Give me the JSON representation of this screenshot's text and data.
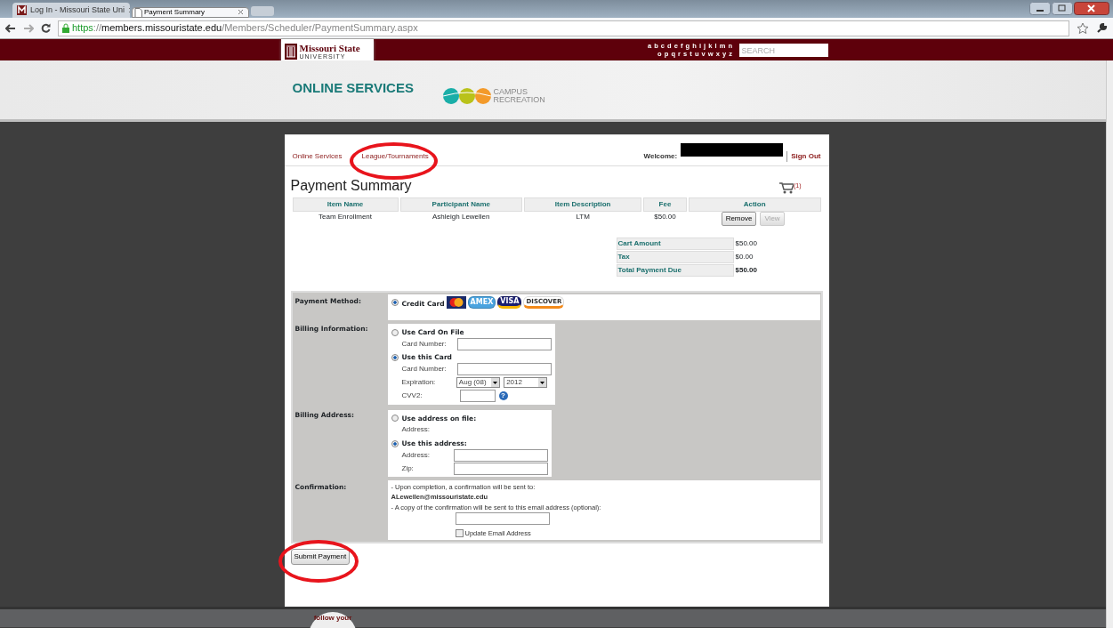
{
  "browser": {
    "tabs": [
      {
        "title": "Log In - Missouri State Uni",
        "selected": false
      },
      {
        "title": "Payment Summary",
        "selected": true
      }
    ],
    "url": {
      "scheme": "https",
      "separator": "://",
      "host": "members.missouristate.edu",
      "path": "/Members/Scheduler/PaymentSummary.aspx"
    }
  },
  "header": {
    "logo_text": "Missouri State",
    "logo_subtext": "UNIVERSITY",
    "az_rows": [
      "a b c d e f g h i j k l m n",
      "o p q r s t u v w x y z"
    ],
    "search": {
      "placeholder": "SEARCH"
    },
    "title": "ONLINE SERVICES",
    "partner": [
      "CAMPUS",
      "RECREATION"
    ]
  },
  "breadcrumb": [
    {
      "label": "Online Services"
    },
    {
      "label": "League/Tournaments"
    }
  ],
  "welcome": {
    "label": "Welcome:"
  },
  "sign_out": "Sign Out",
  "title": "Payment Summary",
  "cart_count": "(1)",
  "items_table": {
    "columns": [
      "Item Name",
      "Participant Name",
      "Item Description",
      "Fee",
      "Action"
    ],
    "rows": [
      {
        "cells": [
          "Team Enrollment",
          "Ashleigh Lewellen",
          "LTM",
          "$50.00"
        ],
        "actions": [
          {
            "label": "Remove",
            "disabled": false
          },
          {
            "label": "View",
            "disabled": true
          }
        ]
      }
    ]
  },
  "totals": [
    {
      "label": "Cart Amount",
      "value": "$50.00",
      "bold": false
    },
    {
      "label": "Tax",
      "value": "$0.00",
      "bold": false
    },
    {
      "label": "Total Payment Due",
      "value": "$50.00",
      "bold": true
    }
  ],
  "payment_method": {
    "label": "Payment Method:",
    "options": [
      {
        "label": "Credit Card",
        "selected": true
      }
    ],
    "cards": [
      {
        "kind": "mastercard"
      },
      {
        "kind": "amex",
        "text": "AMEX"
      },
      {
        "kind": "visa",
        "text": "VISA"
      },
      {
        "kind": "discover",
        "text": "DISCOVER"
      }
    ]
  },
  "billing_info": {
    "label": "Billing Information:",
    "options": [
      {
        "label": "Use Card On File",
        "selected": false,
        "fields": [
          {
            "label": "Card Number:",
            "kind": "text"
          }
        ]
      },
      {
        "label": "Use this Card",
        "selected": true,
        "fields": [
          {
            "label": "Card Number:",
            "kind": "text"
          },
          {
            "label": "Expiration:",
            "kind": "expiry",
            "month": "Aug (08)",
            "year": "2012"
          },
          {
            "label": "CVV2:",
            "kind": "cvv",
            "help": "?"
          }
        ]
      }
    ]
  },
  "billing_address": {
    "label": "Billing Address:",
    "options": [
      {
        "label": "Use address on file:",
        "selected": false,
        "fields": [
          {
            "label": "Address:",
            "kind": "static"
          }
        ]
      },
      {
        "label": "Use this address:",
        "selected": true,
        "fields": [
          {
            "label": "Address:",
            "kind": "text"
          },
          {
            "label": "Zip:",
            "kind": "text"
          }
        ]
      }
    ]
  },
  "confirmation": {
    "label": "Confirmation:",
    "line1": "- Upon completion, a confirmation will be sent to:",
    "email": "ALewellen@missouristate.edu",
    "line2": "- A copy of the confirmation will be sent to this email address (optional):",
    "update": {
      "label": "Update Email Address",
      "checked": false
    }
  },
  "submit": "Submit Payment",
  "footer": {
    "badge": "follow your"
  },
  "annotations": [
    {
      "kind": "ellipse"
    },
    {
      "kind": "ellipse"
    }
  ]
}
